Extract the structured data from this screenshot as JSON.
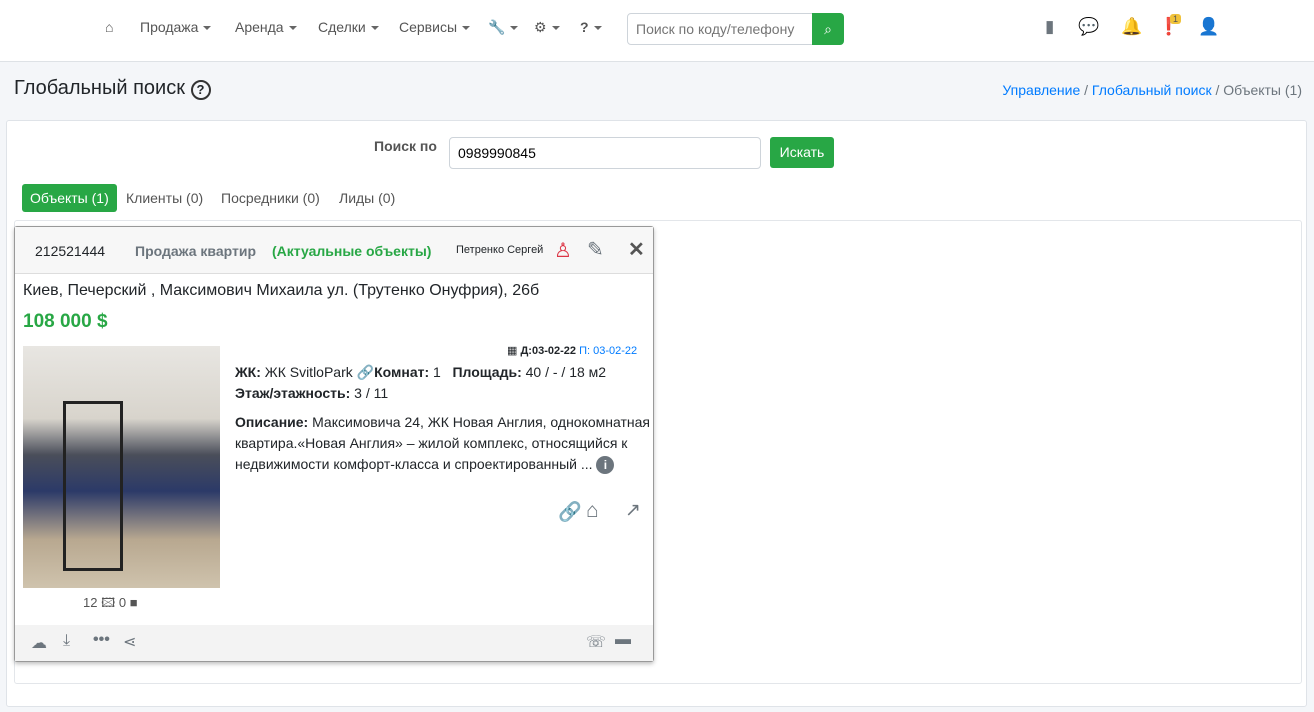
{
  "nav": {
    "home": "home",
    "items": [
      "Продажа",
      "Аренда",
      "Сделки",
      "Сервисы"
    ],
    "search_placeholder": "Поиск по коду/телефону",
    "badge": "1"
  },
  "page": {
    "title": "Глобальный поиск",
    "breadcrumb": [
      "Управление",
      "Глобальный поиск",
      "Объекты (1)"
    ]
  },
  "search": {
    "label": "Поиск по",
    "value": "0989990845",
    "button": "Искать"
  },
  "tabs": [
    "Объекты (1)",
    "Клиенты (0)",
    "Посредники (0)",
    "Лиды (0)"
  ],
  "object": {
    "id": "212521444",
    "type": "Продажа квартир",
    "status": "(Актуальные объекты)",
    "agent": "Петренко Сергей",
    "address": "Киев, Печерский , Максимович Михаила ул. (Трутенко Онуфрия), 26б",
    "price": "108 000 $",
    "date_d": "Д:03-02-22",
    "date_p": "П: 03-02-22",
    "complex_label": "ЖК:",
    "complex": "ЖК SvitloPark",
    "rooms_label": "Комнат:",
    "rooms": "1",
    "area_label": "Площадь:",
    "area": "40 / - / 18 м2",
    "floor_label": "Этаж/этажность:",
    "floor": "3 / 11",
    "desc_label": "Описание:",
    "desc": "Максимовича 24, ЖК Новая Англия, однокомнатная квартира.«Новая Англия» – жилой комплекс, относящийся к недвижимости комфорт-класса и спроектированный ...",
    "photos": "12",
    "videos": "0"
  },
  "colors": {
    "green": "#28a745",
    "blue": "#007bff",
    "red": "#dc3545"
  }
}
